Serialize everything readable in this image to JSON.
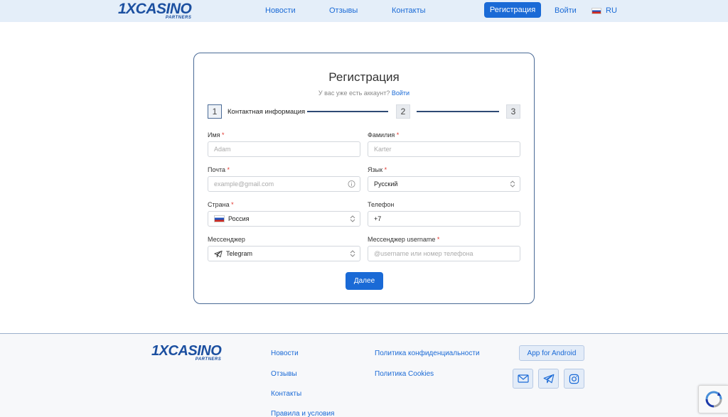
{
  "brand": {
    "logo_main": "1XCASINO",
    "logo_sub": "PARTNERS"
  },
  "header": {
    "nav": [
      "Новости",
      "Отзывы",
      "Контакты"
    ],
    "register_label": "Регистрация",
    "login_label": "Войти",
    "lang_label": "RU"
  },
  "form": {
    "title": "Регистрация",
    "have_account_text": "У вас уже есть аккаунт?",
    "login_link": "Войти",
    "steps": [
      {
        "number": "1",
        "label": "Контактная информация"
      },
      {
        "number": "2"
      },
      {
        "number": "3"
      }
    ],
    "fields": {
      "first_name": {
        "label": "Имя",
        "placeholder": "Adam"
      },
      "last_name": {
        "label": "Фамилия",
        "placeholder": "Karter"
      },
      "email": {
        "label": "Почта",
        "placeholder": "example@gmail.com"
      },
      "language": {
        "label": "Язык",
        "value": "Русский"
      },
      "country": {
        "label": "Страна",
        "value": "Россия"
      },
      "phone": {
        "label": "Телефон",
        "value": "+7"
      },
      "messenger": {
        "label": "Мессенджер",
        "value": "Telegram"
      },
      "messenger_username": {
        "label": "Мессенджер username",
        "placeholder": "@username или номер телефона"
      }
    },
    "required_mark": "*",
    "next_label": "Далее"
  },
  "footer": {
    "links_col1": [
      "Новости",
      "Отзывы",
      "Контакты",
      "Правила и условия"
    ],
    "links_col2": [
      "Политика конфиденциальности",
      "Политика Cookies"
    ],
    "android_label": "App for Android",
    "social_icons": [
      "mail-icon",
      "telegram-icon",
      "instagram-icon"
    ]
  },
  "colors": {
    "accent": "#1a6ad6",
    "brand": "#1b4fa0",
    "header_bg": "#e4eef9",
    "required": "#e0342b"
  }
}
